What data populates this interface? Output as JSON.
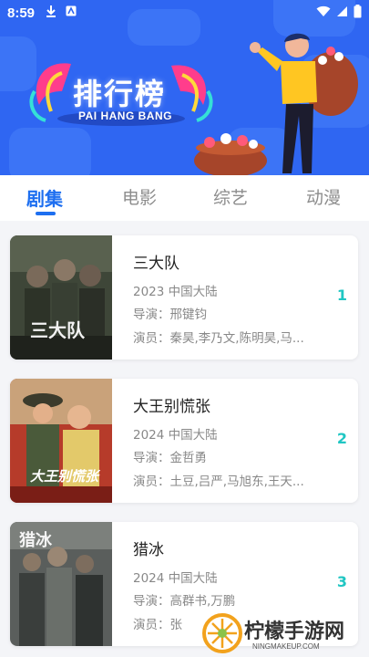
{
  "status_bar": {
    "time": "8:59"
  },
  "banner": {
    "title": "排行榜",
    "subtitle": "PAI HANG BANG"
  },
  "tabs": [
    {
      "label": "剧集",
      "active": true
    },
    {
      "label": "电影",
      "active": false
    },
    {
      "label": "综艺",
      "active": false
    },
    {
      "label": "动漫",
      "active": false
    }
  ],
  "items": [
    {
      "title": "三大队",
      "year_region": "2023 中国大陆",
      "director": "导演：邢键钧",
      "cast": "演员：秦昊,李乃文,陈明昊,马...",
      "rank": "1",
      "poster_text": "三大队"
    },
    {
      "title": "大王别慌张",
      "year_region": "2024 中国大陆",
      "director": "导演：金哲勇",
      "cast": "演员：土豆,吕严,马旭东,王天...",
      "rank": "2",
      "poster_text": "大王别慌张"
    },
    {
      "title": "猎冰",
      "year_region": "2024 中国大陆",
      "director": "导演：高群书,万鹏",
      "cast": "演员：张",
      "rank": "3",
      "poster_text": "猎冰"
    }
  ],
  "watermark": {
    "text": "柠檬手游网",
    "url": "NINGMAKEUP.COM"
  },
  "colors": {
    "banner": "#2f66f2",
    "tab_active": "#1e6ff0",
    "rank": "#20c6c3"
  }
}
